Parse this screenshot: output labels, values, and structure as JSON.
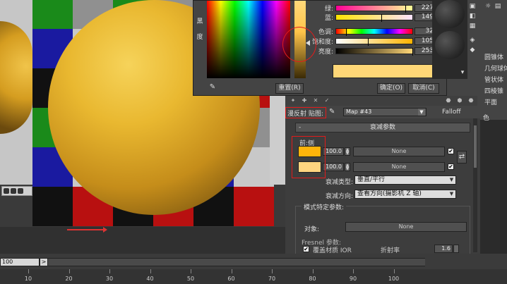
{
  "color_picker": {
    "side_labels": [
      "黑",
      "度"
    ],
    "channels": [
      {
        "label": "绿:",
        "value": "227"
      },
      {
        "label": "蓝:",
        "value": "149"
      },
      {
        "label": "色调:",
        "value": "32"
      },
      {
        "label": "饱和度:",
        "value": "105"
      },
      {
        "label": "亮度:",
        "value": "253"
      }
    ],
    "preview_color": "#ffd777",
    "reset_label": "重置(R)",
    "ok_label": "确定(O)",
    "cancel_label": "取消(C)"
  },
  "command_panel": {
    "items": [
      "圆锥体",
      "几何球体",
      "管状体",
      "四棱锥",
      "平面"
    ],
    "partial_label": "色"
  },
  "material_editor": {
    "map_label": "漫反射 贴图:",
    "map_name": "Map #43",
    "map_type": "Falloff",
    "rollout_title": "衰减参数",
    "rollout_toggle": "-",
    "front_side_label": "前:侧",
    "slots": [
      {
        "color": "#ffb40a",
        "amount": "100.0",
        "map": "None",
        "checked": "✔"
      },
      {
        "color": "#ffd580",
        "amount": "100.0",
        "map": "None",
        "checked": "✔"
      }
    ],
    "falloff_type_label": "衰减类型:",
    "falloff_type_value": "垂直/平行",
    "falloff_dir_label": "衰减方向:",
    "falloff_dir_value": "查看方向(摄影机 Z 轴)",
    "mode_title": "模式特定参数:",
    "object_label": "对象:",
    "object_value": "None",
    "fresnel_label": "Fresnel 参数:",
    "override_label": "覆盖材质 IOR",
    "override_checked": "✔",
    "ior_label": "折射率",
    "ior_value": "1.6"
  },
  "timeline": {
    "frame_field": "100",
    "next_symbol": ">",
    "ticks": [
      "10",
      "20",
      "30",
      "40",
      "50",
      "60",
      "70",
      "80",
      "90",
      "100"
    ]
  },
  "accent_colors": {
    "annotation_red": "#e21b1b",
    "front_color": "#ffb40a",
    "side_color": "#ffd580",
    "sphere_yellow": "#e9b830"
  }
}
